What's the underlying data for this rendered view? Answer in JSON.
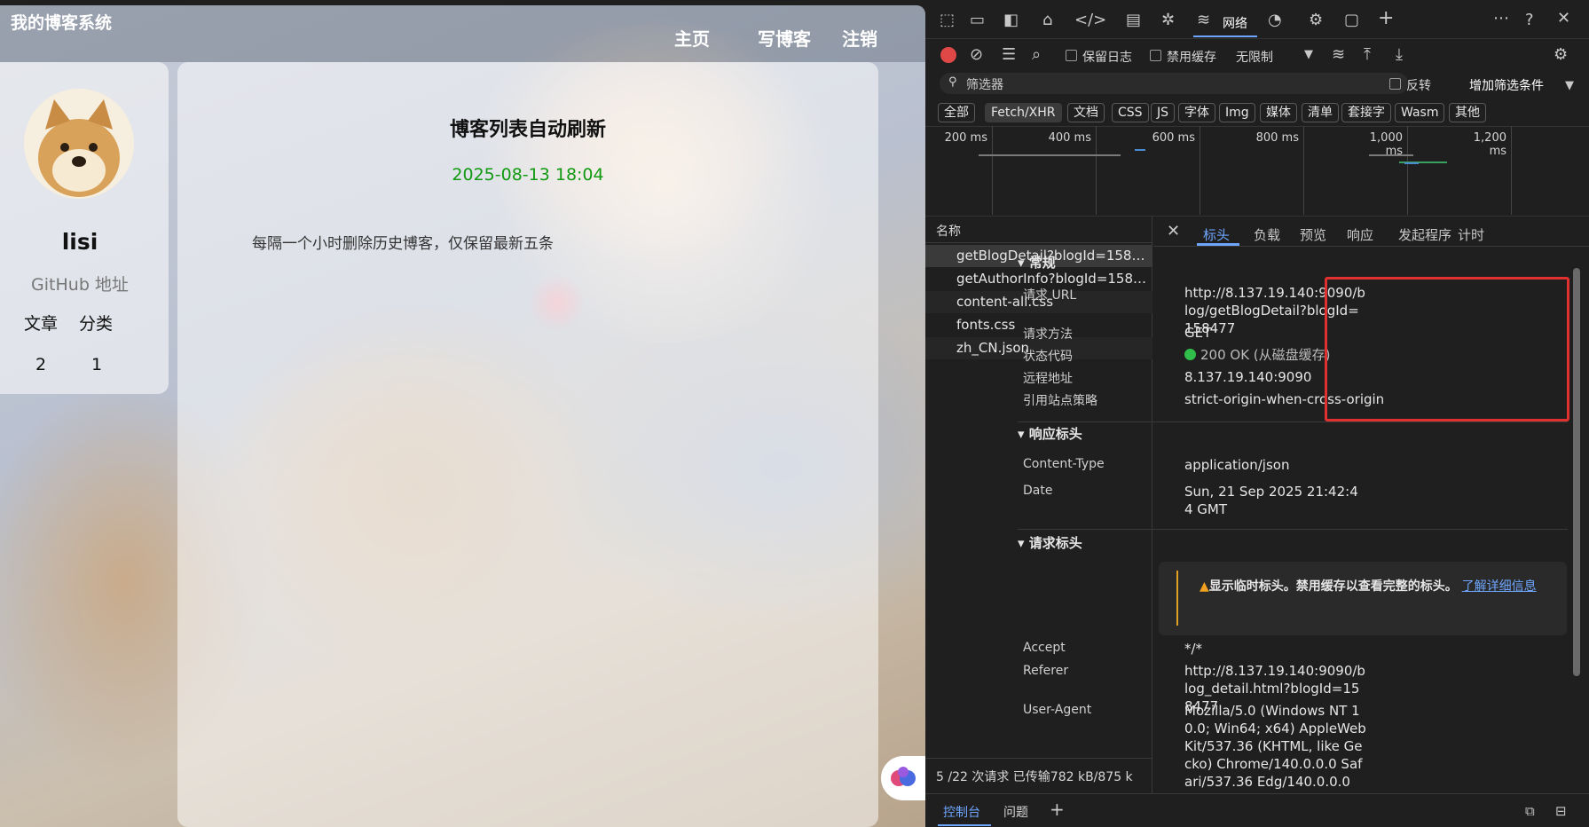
{
  "blog": {
    "site_title": "我的博客系统",
    "nav": {
      "home": "主页",
      "write": "写博客",
      "logout": "注销"
    },
    "profile": {
      "name": "lisi",
      "github": "GitHub 地址",
      "articles_label": "文章",
      "categories_label": "分类",
      "articles": "2",
      "categories": "1"
    },
    "post": {
      "title": "博客列表自动刷新",
      "date": "2025-08-13 18:04",
      "body": "每隔一个小时删除历史博客，仅保留最新五条"
    }
  },
  "devtools": {
    "network_tab": "网络",
    "toolbar": {
      "preserve_log": "保留日志",
      "disable_cache": "禁用缓存",
      "throttle": "无限制"
    },
    "filter": {
      "placeholder": "筛选器",
      "invert": "反转",
      "more_filters": "增加筛选条件"
    },
    "type_filters": [
      "全部",
      "Fetch/XHR",
      "文档",
      "CSS",
      "JS",
      "字体",
      "Img",
      "媒体",
      "清单",
      "套接字",
      "Wasm",
      "其他"
    ],
    "timeline_ticks": [
      "200 ms",
      "400 ms",
      "600 ms",
      "800 ms",
      "1,000 ms",
      "1,200 ms"
    ],
    "name_header": "名称",
    "requests": [
      "getBlogDetail?blogId=1584...",
      "getAuthorInfo?blogId=1584...",
      "content-all.css",
      "fonts.css",
      "zh_CN.json"
    ],
    "summary": "5 /22 次请求   已传输782 kB/875 k",
    "detail_tabs": [
      "标头",
      "负载",
      "预览",
      "响应",
      "发起程序",
      "计时"
    ],
    "general": {
      "title": "常规",
      "request_url_label": "请求 URL",
      "request_url": "http://8.137.19.140:9090/blog/getBlogDetail?blogId=158477",
      "method_label": "请求方法",
      "method": "GET",
      "status_label": "状态代码",
      "status": "200 OK (从磁盘缓存)",
      "remote_label": "远程地址",
      "remote": "8.137.19.140:9090",
      "referrer_policy_label": "引用站点策略",
      "referrer_policy": "strict-origin-when-cross-origin"
    },
    "response_headers": {
      "title": "响应标头",
      "content_type_label": "Content-Type",
      "content_type": "application/json",
      "date_label": "Date",
      "date": "Sun, 21 Sep 2025 21:42:44 GMT"
    },
    "request_headers": {
      "title": "请求标头",
      "warning": "显示临时标头。禁用缓存以查看完整的标头。",
      "learn_more": "了解详细信息",
      "accept_label": "Accept",
      "accept": "*/*",
      "referer_label": "Referer",
      "referer": "http://8.137.19.140:9090/blog_detail.html?blogId=158477",
      "ua_label": "User-Agent",
      "ua": "Mozilla/5.0 (Windows NT 10.0; Win64; x64) AppleWebKit/537.36 (KHTML, like Gecko) Chrome/140.0.0.0 Safari/537.36 Edg/140.0.0.0"
    },
    "drawer": {
      "console": "控制台",
      "issues": "问题"
    },
    "colors": {
      "highlight_box": "#e03030",
      "status_ok": "#2fbf4a",
      "date_green": "#119911",
      "link": "#6ea6ff"
    }
  }
}
